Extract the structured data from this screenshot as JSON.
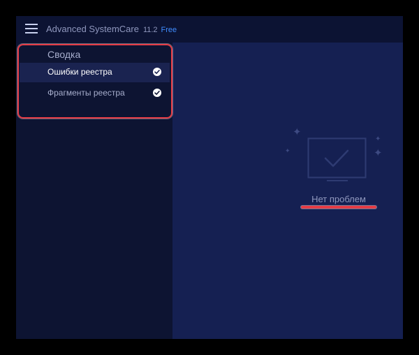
{
  "app": {
    "name": "Advanced SystemCare",
    "version": "11.2",
    "edition": "Free",
    "edition_color": "#3f8cff"
  },
  "icons": {
    "menu": "hamburger-menu-icon",
    "check": "check-circle-icon",
    "empty_state": "monitor-check-icon",
    "sparkle": "sparkle-icon"
  },
  "sidebar": {
    "summary_title": "Сводка",
    "items": [
      {
        "label": "Ошибки реестра",
        "checked": true,
        "active": true
      },
      {
        "label": "Фрагменты реестра",
        "checked": true,
        "active": false
      }
    ]
  },
  "main": {
    "status": "Нет проблем"
  },
  "colors": {
    "highlight": "#e63c46",
    "window_bg": "#111a40",
    "sidebar_bg": "#0d1432",
    "main_bg": "#152052"
  }
}
